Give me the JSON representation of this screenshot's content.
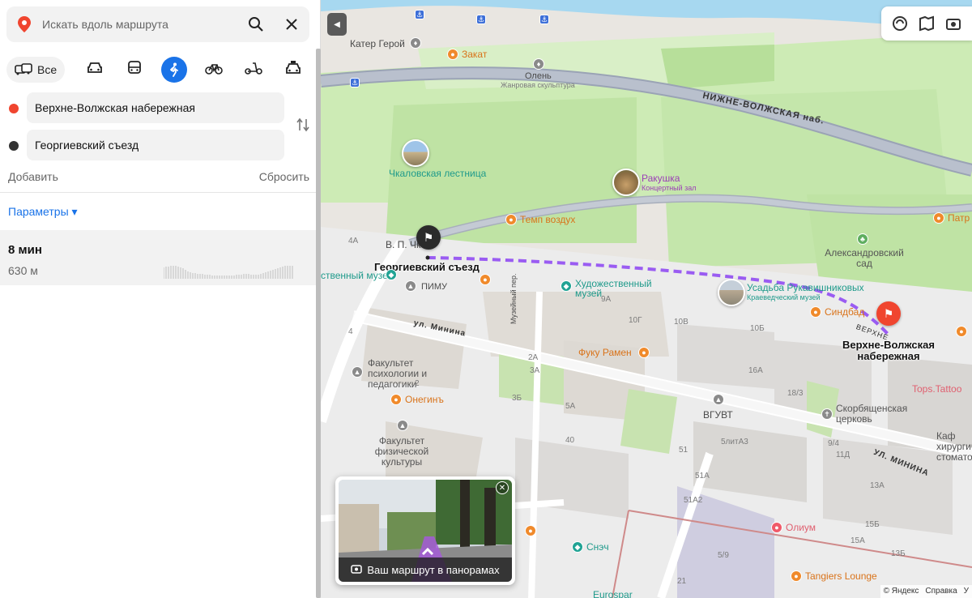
{
  "search": {
    "placeholder": "Искать вдоль маршрута"
  },
  "modes": {
    "all_label": "Все",
    "items": [
      "car-icon",
      "bus-icon",
      "walk-icon",
      "bike-icon",
      "scooter-icon",
      "taxi-icon"
    ],
    "active": "walk-icon"
  },
  "route_points": [
    {
      "value": "Верхне-Волжская набережная",
      "dot_color": "#f0452f"
    },
    {
      "value": "Георгиевский съезд",
      "dot_color": "#333333"
    }
  ],
  "actions": {
    "add": "Добавить",
    "reset": "Сбросить"
  },
  "params_label": "Параметры ▾",
  "route": {
    "time": "8 мин",
    "distance": "630 м"
  },
  "map": {
    "labels": {
      "kater": "Катер Герой",
      "zakat": "Закат",
      "olen": "Олень",
      "olen_sub": "Жанровая скульптура",
      "nizhne_road": "НИЖНЕ-ВОЛЖСКАЯ наб.",
      "chkalov": "Чкаловская лестница",
      "rakushka": "Ракушка",
      "rakushka_sub": "Концертный зал",
      "temp": "Темп воздух",
      "patr": "Патр",
      "aleks": "Александровский сад",
      "vp_chk": "В. П. Чк",
      "georg": "Георгиевский съезд",
      "muzei_left": "ственный музей",
      "pimu": "ПИМУ",
      "khud": "Художественный музей",
      "usadba": "Усадьба Рукавишниковых",
      "usadba_sub": "Краеведческий музей",
      "sindbad": "Синдбад",
      "verkhne": "Верхне-Волжская набережная",
      "verkhne_road": "ВЕРХНЕ",
      "minina": "ул. Минина",
      "muzeinyi": "Музейный пер.",
      "fuku": "Фуку Рамен",
      "fak_psych": "Факультет психологии и педагогики",
      "onegin": "Онегинъ",
      "vguvt": "ВГУВТ",
      "tops": "Tops.Tattoo",
      "skorb": "Скорбященская церковь",
      "kaf": "Каф хирургиче стомато",
      "minina2": "УЛ. МИНИНА",
      "fak_fiz": "Факультет физической культуры",
      "oliu": "Олиум",
      "snech": "Снэч",
      "tangiers": "Tangiers Lounge",
      "eurospar": "Eurospar"
    },
    "house_numbers": [
      "4А",
      "4",
      "9А",
      "10Г",
      "10В",
      "10Б",
      "2А",
      "3А",
      "3Б",
      "5А",
      "40",
      "2",
      "16А",
      "18/3",
      "5литА3",
      "51",
      "51А",
      "9/4",
      "11Д",
      "13А",
      "15Б",
      "15А",
      "13Б",
      "5/9",
      "51А2",
      "21",
      "4"
    ],
    "panorama": {
      "caption": "Ваш маршрут в панорамах"
    },
    "copyright": {
      "yandex": "© Яндекс",
      "help": "Справка",
      "extra": "У"
    }
  }
}
